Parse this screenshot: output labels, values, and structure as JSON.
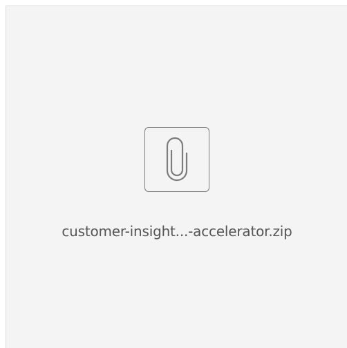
{
  "attachment": {
    "file_name": "customer-insight...-accelerator.zip",
    "icon": "paperclip-icon"
  }
}
